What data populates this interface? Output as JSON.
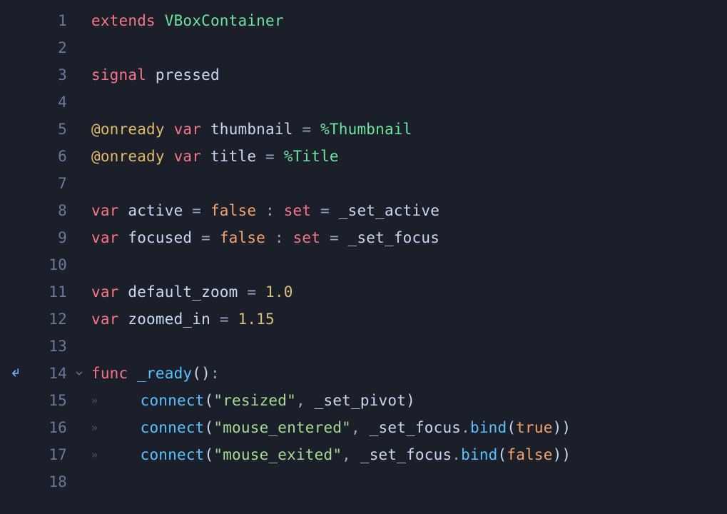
{
  "lines": [
    {
      "n": "1",
      "fold": "",
      "marker": "",
      "tokens": [
        [
          "kw-red",
          "extends"
        ],
        [
          "sp",
          " "
        ],
        [
          "type",
          "VBoxContainer"
        ]
      ]
    },
    {
      "n": "2",
      "fold": "",
      "marker": "",
      "tokens": []
    },
    {
      "n": "3",
      "fold": "",
      "marker": "",
      "tokens": [
        [
          "kw-red",
          "signal"
        ],
        [
          "sp",
          " "
        ],
        [
          "ident",
          "pressed"
        ]
      ]
    },
    {
      "n": "4",
      "fold": "",
      "marker": "",
      "tokens": []
    },
    {
      "n": "5",
      "fold": "",
      "marker": "",
      "tokens": [
        [
          "ann",
          "@onready"
        ],
        [
          "sp",
          " "
        ],
        [
          "kw-red",
          "var"
        ],
        [
          "sp",
          " "
        ],
        [
          "ident",
          "thumbnail"
        ],
        [
          "sp",
          " "
        ],
        [
          "punct",
          "="
        ],
        [
          "sp",
          " "
        ],
        [
          "unique",
          "%Thumbnail"
        ]
      ]
    },
    {
      "n": "6",
      "fold": "",
      "marker": "",
      "tokens": [
        [
          "ann",
          "@onready"
        ],
        [
          "sp",
          " "
        ],
        [
          "kw-red",
          "var"
        ],
        [
          "sp",
          " "
        ],
        [
          "ident",
          "title"
        ],
        [
          "sp",
          " "
        ],
        [
          "punct",
          "="
        ],
        [
          "sp",
          " "
        ],
        [
          "unique",
          "%Title"
        ]
      ]
    },
    {
      "n": "7",
      "fold": "",
      "marker": "",
      "tokens": []
    },
    {
      "n": "8",
      "fold": "",
      "marker": "",
      "tokens": [
        [
          "kw-red",
          "var"
        ],
        [
          "sp",
          " "
        ],
        [
          "ident",
          "active"
        ],
        [
          "sp",
          " "
        ],
        [
          "punct",
          "="
        ],
        [
          "sp",
          " "
        ],
        [
          "kw-orange",
          "false"
        ],
        [
          "sp",
          " "
        ],
        [
          "punct",
          ":"
        ],
        [
          "sp",
          " "
        ],
        [
          "kw-red",
          "set"
        ],
        [
          "sp",
          " "
        ],
        [
          "punct",
          "="
        ],
        [
          "sp",
          " "
        ],
        [
          "ident",
          "_set_active"
        ]
      ]
    },
    {
      "n": "9",
      "fold": "",
      "marker": "",
      "tokens": [
        [
          "kw-red",
          "var"
        ],
        [
          "sp",
          " "
        ],
        [
          "ident",
          "focused"
        ],
        [
          "sp",
          " "
        ],
        [
          "punct",
          "="
        ],
        [
          "sp",
          " "
        ],
        [
          "kw-orange",
          "false"
        ],
        [
          "sp",
          " "
        ],
        [
          "punct",
          ":"
        ],
        [
          "sp",
          " "
        ],
        [
          "kw-red",
          "set"
        ],
        [
          "sp",
          " "
        ],
        [
          "punct",
          "="
        ],
        [
          "sp",
          " "
        ],
        [
          "ident",
          "_set_focus"
        ]
      ]
    },
    {
      "n": "10",
      "fold": "",
      "marker": "",
      "tokens": []
    },
    {
      "n": "11",
      "fold": "",
      "marker": "",
      "tokens": [
        [
          "kw-red",
          "var"
        ],
        [
          "sp",
          " "
        ],
        [
          "ident",
          "default_zoom"
        ],
        [
          "sp",
          " "
        ],
        [
          "punct",
          "="
        ],
        [
          "sp",
          " "
        ],
        [
          "num",
          "1.0"
        ]
      ]
    },
    {
      "n": "12",
      "fold": "",
      "marker": "",
      "tokens": [
        [
          "kw-red",
          "var"
        ],
        [
          "sp",
          " "
        ],
        [
          "ident",
          "zoomed_in"
        ],
        [
          "sp",
          " "
        ],
        [
          "punct",
          "="
        ],
        [
          "sp",
          " "
        ],
        [
          "num",
          "1.15"
        ]
      ]
    },
    {
      "n": "13",
      "fold": "",
      "marker": "",
      "tokens": []
    },
    {
      "n": "14",
      "fold": "open",
      "marker": "enter",
      "tokens": [
        [
          "kw-red",
          "func"
        ],
        [
          "sp",
          " "
        ],
        [
          "fn",
          "_ready"
        ],
        [
          "punct2",
          "()"
        ],
        [
          "punct",
          ":"
        ]
      ]
    },
    {
      "n": "15",
      "fold": "",
      "marker": "",
      "tokens": [
        [
          "indent",
          "»"
        ],
        [
          "sp",
          "    "
        ],
        [
          "fn",
          "connect"
        ],
        [
          "punct2",
          "("
        ],
        [
          "str",
          "\"resized\""
        ],
        [
          "punct",
          ","
        ],
        [
          "sp",
          " "
        ],
        [
          "ident",
          "_set_pivot"
        ],
        [
          "punct2",
          ")"
        ]
      ]
    },
    {
      "n": "16",
      "fold": "",
      "marker": "",
      "tokens": [
        [
          "indent",
          "»"
        ],
        [
          "sp",
          "    "
        ],
        [
          "fn",
          "connect"
        ],
        [
          "punct2",
          "("
        ],
        [
          "str",
          "\"mouse_entered\""
        ],
        [
          "punct",
          ","
        ],
        [
          "sp",
          " "
        ],
        [
          "ident",
          "_set_focus"
        ],
        [
          "punct",
          "."
        ],
        [
          "fn",
          "bind"
        ],
        [
          "punct2",
          "("
        ],
        [
          "kw-orange",
          "true"
        ],
        [
          "punct2",
          "))"
        ]
      ]
    },
    {
      "n": "17",
      "fold": "",
      "marker": "",
      "tokens": [
        [
          "indent",
          "»"
        ],
        [
          "sp",
          "    "
        ],
        [
          "fn",
          "connect"
        ],
        [
          "punct2",
          "("
        ],
        [
          "str",
          "\"mouse_exited\""
        ],
        [
          "punct",
          ","
        ],
        [
          "sp",
          " "
        ],
        [
          "ident",
          "_set_focus"
        ],
        [
          "punct",
          "."
        ],
        [
          "fn",
          "bind"
        ],
        [
          "punct2",
          "("
        ],
        [
          "kw-orange",
          "false"
        ],
        [
          "punct2",
          "))"
        ]
      ]
    },
    {
      "n": "18",
      "fold": "",
      "marker": "",
      "tokens": []
    }
  ]
}
